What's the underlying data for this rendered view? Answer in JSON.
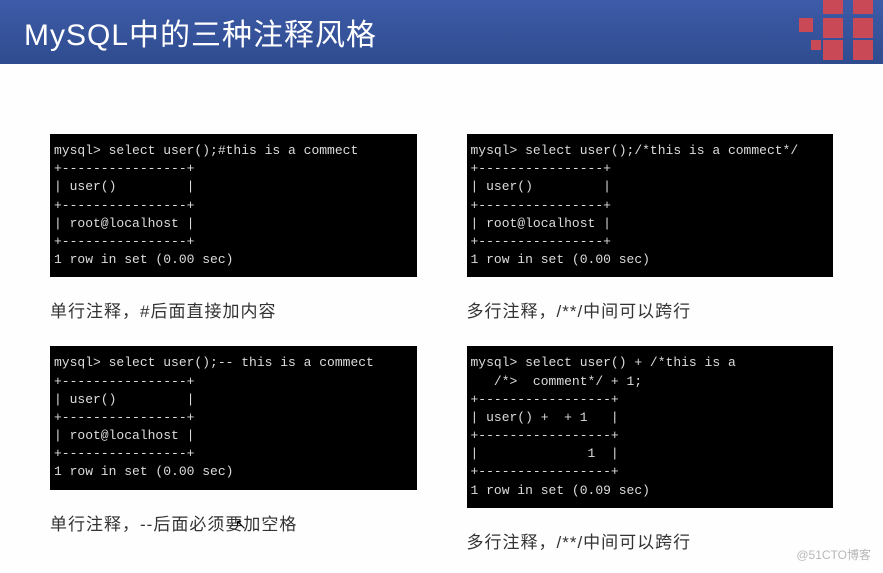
{
  "header": {
    "title": "MySQL中的三种注释风格"
  },
  "blocks": {
    "top_left": {
      "terminal": "mysql> select user();#this is a commect\n+----------------+\n| user()         |\n+----------------+\n| root@localhost |\n+----------------+\n1 row in set (0.00 sec)",
      "caption": "单行注释，#后面直接加内容"
    },
    "top_right": {
      "terminal": "mysql> select user();/*this is a commect*/\n+----------------+\n| user()         |\n+----------------+\n| root@localhost |\n+----------------+\n1 row in set (0.00 sec)",
      "caption": "多行注释，/**/中间可以跨行"
    },
    "bottom_left": {
      "terminal": "mysql> select user();-- this is a commect\n+----------------+\n| user()         |\n+----------------+\n| root@localhost |\n+----------------+\n1 row in set (0.00 sec)",
      "caption": "单行注释，--后面必须要加空格"
    },
    "bottom_right": {
      "terminal": "mysql> select user() + /*this is a\n   /*>  comment*/ + 1;\n+-----------------+\n| user() +  + 1   |\n+-----------------+\n|              1  |\n+-----------------+\n1 row in set (0.09 sec)",
      "caption": "多行注释，/**/中间可以跨行"
    }
  },
  "watermark": "@51CTO博客"
}
